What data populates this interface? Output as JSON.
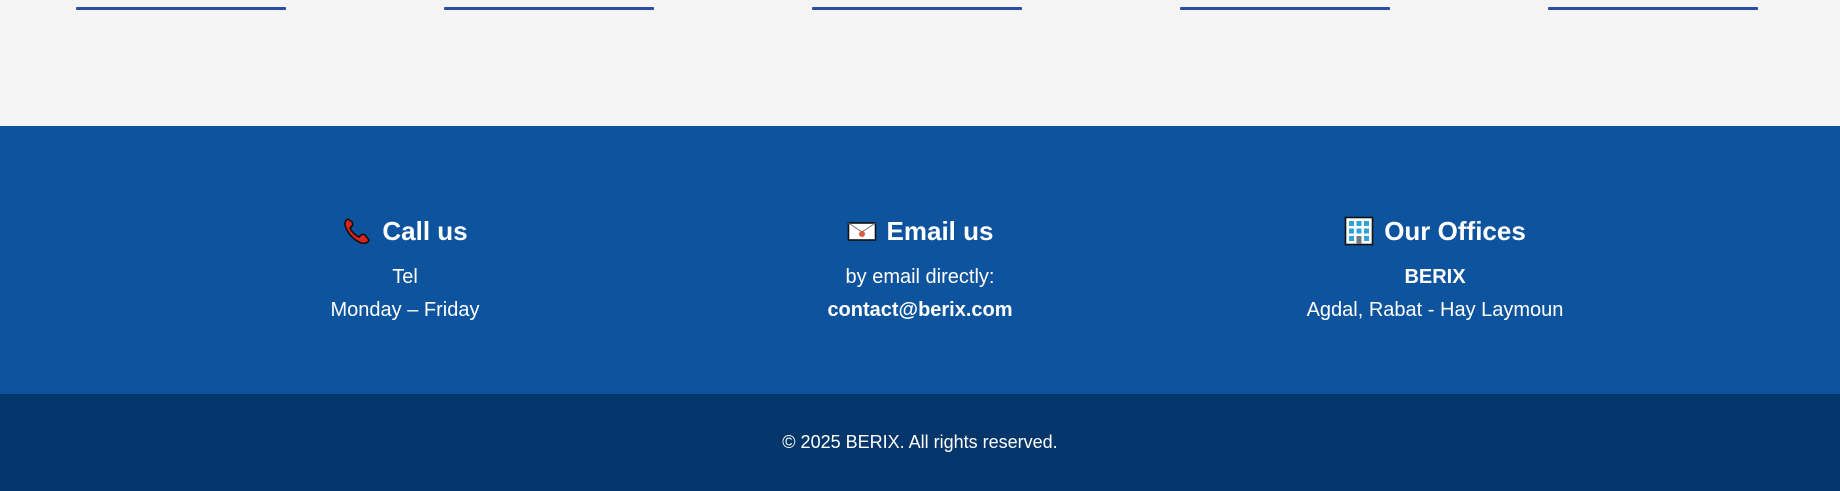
{
  "colors": {
    "top_background": "#f5f5f5",
    "accent_line": "#2a4ea3",
    "contact_background": "#0e539d",
    "footer_background": "#05366b",
    "text": "#ffffff"
  },
  "contact": {
    "call": {
      "icon": "telephone-icon",
      "title": "Call us",
      "line1": "Tel",
      "line2": "Monday – Friday"
    },
    "email": {
      "icon": "envelope-icon",
      "title": "Email us",
      "line1": "by email directly:",
      "line2": "contact@berix.com"
    },
    "office": {
      "icon": "office-building-icon",
      "title": "Our Offices",
      "line1": "BERIX",
      "line2": "Agdal, Rabat - Hay Laymoun"
    }
  },
  "footer": {
    "copyright": "© 2025 BERIX. All rights reserved."
  }
}
